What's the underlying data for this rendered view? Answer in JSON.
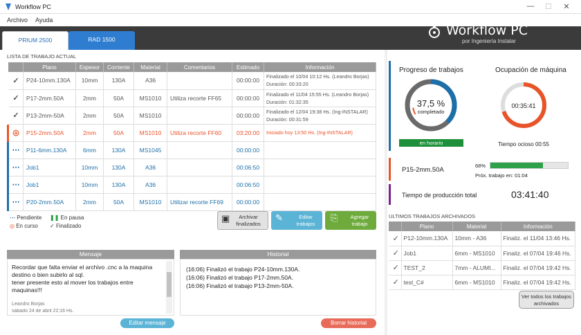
{
  "window": {
    "title": "Workflow PC",
    "min": "—",
    "max": "☐",
    "close": "✕"
  },
  "menu": [
    "Archivo",
    "Ayuda"
  ],
  "tabs": [
    "PRIUM 2500",
    "RAD 1500"
  ],
  "brand": {
    "name": "Workflow PC",
    "sub": "por Ingeniería Instalar"
  },
  "worklist": {
    "title": "LISTA DE TRABAJO ACTUAL",
    "columns": [
      "Plano",
      "Espesor",
      "Corriente",
      "Material",
      "Comentarios",
      "Estimado",
      "Información"
    ],
    "rows": [
      {
        "status": "done",
        "plano": "P24-10mm.130A",
        "espesor": "10mm",
        "corriente": "130A",
        "material": "A36",
        "comentarios": "",
        "estimado": "00:00:00",
        "info1": "Finalizado el 10/04 10:12 Hs. (Leandro Borjas)",
        "info2": "Duración: 00:33:20"
      },
      {
        "status": "done",
        "plano": "P17-2mm.50A",
        "espesor": "2mm",
        "corriente": "50A",
        "material": "MS1010",
        "comentarios": "Utiliza recorte FF65",
        "estimado": "00:00:00",
        "info1": "Finalizado el 11/04 15:55 Hs. (Leandro Borjas)",
        "info2": "Duración: 01:32:35"
      },
      {
        "status": "done",
        "plano": "P13-2mm-50A",
        "espesor": "2mm",
        "corriente": "50A",
        "material": "MS1010",
        "comentarios": "",
        "estimado": "00:00:00",
        "info1": "Finalizado el 12/04 19:38 Hs. (Ing-INSTALAR)",
        "info2": "Duración: 00:31:59"
      },
      {
        "status": "curso",
        "plano": "P15-2mm.50A",
        "espesor": "2mm",
        "corriente": "50A",
        "material": "MS1010",
        "comentarios": "Utiliza recorte FF60",
        "estimado": "03:20:00",
        "info1": "Iniciado hoy 13:50 Hs. (Ing-INSTALAR)",
        "info2": ""
      },
      {
        "status": "pend",
        "plano": "P11-6mm.130A",
        "espesor": "6mm",
        "corriente": "130A",
        "material": "MS1045",
        "comentarios": "",
        "estimado": "00:00:00",
        "info1": "",
        "info2": ""
      },
      {
        "status": "pend",
        "plano": "Job1",
        "espesor": "10mm",
        "corriente": "130A",
        "material": "A36",
        "comentarios": "",
        "estimado": "00:06:50",
        "info1": "",
        "info2": ""
      },
      {
        "status": "pend",
        "plano": "Job1",
        "espesor": "10mm",
        "corriente": "130A",
        "material": "A36",
        "comentarios": "",
        "estimado": "00:06:50",
        "info1": "",
        "info2": ""
      },
      {
        "status": "pend",
        "plano": "P20-2mm.50A",
        "espesor": "2mm",
        "corriente": "50A",
        "material": "MS1010",
        "comentarios": "Utilizar recorte FF69",
        "estimado": "00:00:00",
        "info1": "",
        "info2": ""
      }
    ]
  },
  "legend": {
    "pendiente": "Pendiente",
    "pausa": "En pausa",
    "curso": "En curso",
    "finalizado": "Finalizado"
  },
  "actions": {
    "archivar": "Archivar finalizados",
    "editar": "Editar trabajos",
    "agregar": "Agregar trabajo"
  },
  "mensaje": {
    "title": "Mensaje",
    "text": "Recordar que falta enviar el archivo .cnc a la maquina destino o bien subirlo al sql.\ntener presente esto al mover los trabajos entre maquinas!!!",
    "author": "Leandro Borjas",
    "date": "sábado 24 de abril 22:16 Hs.",
    "button": "Editar mensaje"
  },
  "historial": {
    "title": "Historial",
    "items": [
      "(16:06) Finalizó el trabajo P24-10mm.130A.",
      "(16:06) Finalizó el trabajo P17-2mm.50A.",
      "(16:06) Finalizó el trabajo P13-2mm-50A."
    ],
    "button": "Borrar historial"
  },
  "progreso": {
    "title": "Progreso de trabajos",
    "percent": "37,5 %",
    "sub": "completado",
    "value": 0.375,
    "badge": "en horario"
  },
  "ocupacion": {
    "title": "Ocupación de máquina",
    "time": "00:35:41",
    "value": 0.7,
    "idle": "Tiempo ocioso 00:55"
  },
  "current": {
    "job": "P15-2mm.50A",
    "pct": "68%",
    "value": 0.68,
    "next": "Próx. trabajo en: 01:04"
  },
  "produccion": {
    "label": "Tiempo de producción total",
    "time": "03:41:40"
  },
  "archivados": {
    "title": "ULTIMOS TRABAJOS ARCHIVADOS",
    "columns": [
      "Plano",
      "Material",
      "Información"
    ],
    "rows": [
      {
        "plano": "P12-10mm.130A",
        "material": "10mm - A36",
        "info": "Finaliz. el 11/04 13:46 Hs."
      },
      {
        "plano": "Job1",
        "material": "6mm - MS1010",
        "info": "Finaliz. el 07/04 19:46 Hs."
      },
      {
        "plano": "TEST_2",
        "material": "7mm - ALUMI...",
        "info": "Finaliz. el 07/04 19:42 Hs."
      },
      {
        "plano": "test_C#",
        "material": "6mm - MS1010",
        "info": "Finaliz. el 07/04 19:42 Hs."
      }
    ],
    "button": "Ver todos los trabajos archivados"
  },
  "colors": {
    "blue": "#1d6fa8",
    "orange": "#e8542a",
    "green": "#2ea04a",
    "purple": "#7a1f8f"
  }
}
